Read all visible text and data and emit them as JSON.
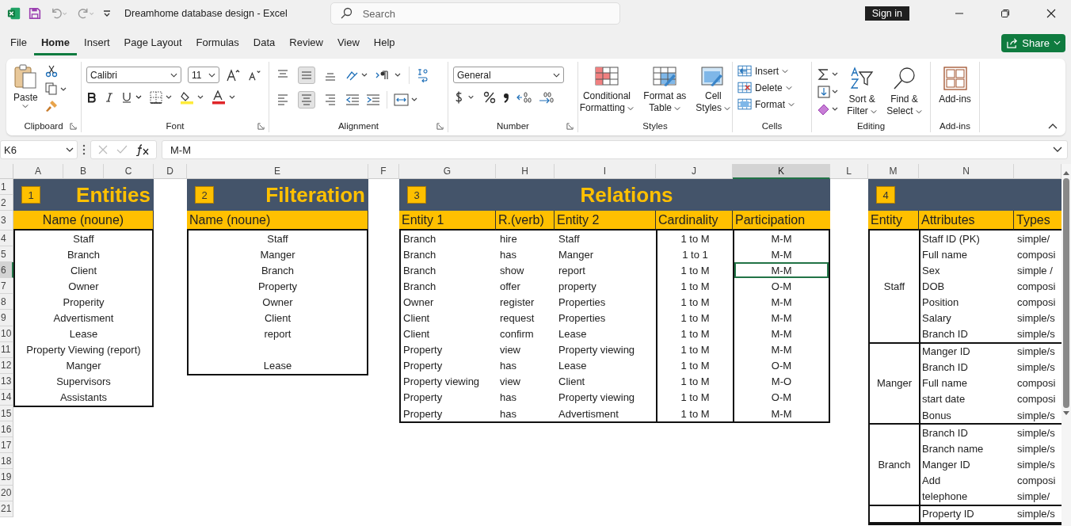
{
  "title_bar": {
    "document_title": "Dreamhome database design  -  Excel",
    "search_placeholder": "Search",
    "sign_in": "Sign in"
  },
  "menu_tabs": [
    {
      "label": "File",
      "selected": false
    },
    {
      "label": "Home",
      "selected": true
    },
    {
      "label": "Insert",
      "selected": false
    },
    {
      "label": "Page Layout",
      "selected": false
    },
    {
      "label": "Formulas",
      "selected": false
    },
    {
      "label": "Data",
      "selected": false
    },
    {
      "label": "Review",
      "selected": false
    },
    {
      "label": "View",
      "selected": false
    },
    {
      "label": "Help",
      "selected": false
    }
  ],
  "share_button": "Share",
  "ribbon": {
    "clipboard": {
      "paste": "Paste",
      "group": "Clipboard"
    },
    "font": {
      "font_name": "Calibri",
      "font_size": "11",
      "group": "Font"
    },
    "alignment": {
      "vertical_buttons": [
        {
          "selected": false
        },
        {
          "selected": true
        },
        {
          "selected": false
        }
      ],
      "horizontal_buttons": [
        {
          "selected": false
        },
        {
          "selected": true
        },
        {
          "selected": false
        }
      ],
      "group": "Alignment"
    },
    "number": {
      "format": "General",
      "group": "Number"
    },
    "styles": {
      "buttons": [
        [
          "Conditional",
          "Formatting"
        ],
        [
          "Format as",
          "Table"
        ],
        [
          "Cell",
          "Styles"
        ]
      ],
      "group": "Styles"
    },
    "cells": {
      "buttons": [
        "Insert",
        "Delete",
        "Format"
      ],
      "group": "Cells"
    },
    "editing": {
      "buttons": [
        [
          "Sort &",
          "Filter"
        ],
        [
          "Find &",
          "Select"
        ]
      ],
      "group": "Editing"
    },
    "addins": {
      "button": "Add-ins",
      "group": "Add-ins"
    }
  },
  "formula_bar": {
    "name_box": "K6",
    "formula": "M-M"
  },
  "sheet": {
    "columns": [
      {
        "label": "A",
        "selected": false
      },
      {
        "label": "B",
        "selected": false
      },
      {
        "label": "C",
        "selected": false
      },
      {
        "label": "D",
        "selected": false
      },
      {
        "label": "E",
        "selected": false
      },
      {
        "label": "F",
        "selected": false
      },
      {
        "label": "G",
        "selected": false
      },
      {
        "label": "H",
        "selected": false
      },
      {
        "label": "I",
        "selected": false
      },
      {
        "label": "J",
        "selected": false
      },
      {
        "label": "K",
        "selected": true
      },
      {
        "label": "L",
        "selected": false
      },
      {
        "label": "M",
        "selected": false
      },
      {
        "label": "N",
        "selected": false
      }
    ],
    "rows": [
      {
        "label": "1",
        "selected": false
      },
      {
        "label": "2",
        "selected": false
      },
      {
        "label": "3",
        "selected": false
      },
      {
        "label": "4",
        "selected": false
      },
      {
        "label": "5",
        "selected": false
      },
      {
        "label": "6",
        "selected": true
      },
      {
        "label": "7",
        "selected": false
      },
      {
        "label": "8",
        "selected": false
      },
      {
        "label": "9",
        "selected": false
      },
      {
        "label": "10",
        "selected": false
      },
      {
        "label": "11",
        "selected": false
      },
      {
        "label": "12",
        "selected": false
      },
      {
        "label": "13",
        "selected": false
      },
      {
        "label": "14",
        "selected": false
      },
      {
        "label": "15",
        "selected": false
      },
      {
        "label": "16",
        "selected": false
      },
      {
        "label": "17",
        "selected": false
      },
      {
        "label": "18",
        "selected": false
      },
      {
        "label": "19",
        "selected": false
      },
      {
        "label": "20",
        "selected": false
      },
      {
        "label": "21",
        "selected": false
      }
    ]
  },
  "entities": {
    "badge": "1",
    "title": "Entities",
    "header": "Name  (noune)",
    "items": [
      "Staff",
      "Branch",
      "Client",
      "Owner",
      "Properity",
      "Advertisment",
      "Lease",
      "Property Viewing (report)",
      "Manger",
      "Supervisors",
      "Assistants"
    ]
  },
  "filteration": {
    "badge": "2",
    "title": "Filteration",
    "header": "Name  (noune)",
    "items": [
      "Staff",
      "Manger",
      "Branch",
      "Property",
      "Owner",
      "Client",
      "report"
    ],
    "last_item": "Lease"
  },
  "relations": {
    "badge": "3",
    "title": "Relations",
    "headers": [
      "Entity 1",
      "R.(verb)",
      "Entity 2",
      "Cardinality",
      "Participation"
    ],
    "rows": [
      {
        "entity1": "Branch",
        "verb": "hire",
        "entity2": "Staff",
        "cardinality": "1 to M",
        "participation": "M-M",
        "selected": false
      },
      {
        "entity1": "Branch",
        "verb": "has",
        "entity2": "Manger",
        "cardinality": "1 to 1",
        "participation": "M-M",
        "selected": false
      },
      {
        "entity1": "Branch",
        "verb": "show",
        "entity2": "report",
        "cardinality": "1 to M",
        "participation": "M-M",
        "selected": true
      },
      {
        "entity1": "Branch",
        "verb": "offer",
        "entity2": "property",
        "cardinality": "1 to M",
        "participation": "O-M",
        "selected": false
      },
      {
        "entity1": "Owner",
        "verb": "register",
        "entity2": "Properties",
        "cardinality": "1 to M",
        "participation": "M-M",
        "selected": false
      },
      {
        "entity1": "Client",
        "verb": "request",
        "entity2": "Properties",
        "cardinality": "1 to M",
        "participation": "M-M",
        "selected": false
      },
      {
        "entity1": "Client",
        "verb": "confirm",
        "entity2": "Lease",
        "cardinality": "1 to M",
        "participation": "M-M",
        "selected": false
      },
      {
        "entity1": "Property",
        "verb": "view",
        "entity2": "Property viewing",
        "cardinality": "1 to M",
        "participation": "M-M",
        "selected": false
      },
      {
        "entity1": "Property",
        "verb": "has",
        "entity2": "Lease",
        "cardinality": "1 to M",
        "participation": "O-M",
        "selected": false
      },
      {
        "entity1": "Property viewing",
        "verb": "view",
        "entity2": "Client",
        "cardinality": "1 to M",
        "participation": "M-O",
        "selected": false
      },
      {
        "entity1": "Property",
        "verb": "has",
        "entity2": "Property viewing",
        "cardinality": "1 to M",
        "participation": "O-M",
        "selected": false
      },
      {
        "entity1": "Property",
        "verb": "has",
        "entity2": "Advertisment",
        "cardinality": "1 to M",
        "participation": "M-M",
        "selected": false
      }
    ]
  },
  "attributes": {
    "badge": "4",
    "headers": [
      "Entity",
      "Attributes",
      "Types"
    ],
    "groups": [
      {
        "entity": "Staff",
        "attributes": [
          {
            "name": "Staff ID (PK)",
            "type": "simple/"
          },
          {
            "name": "Full name",
            "type": "composi"
          },
          {
            "name": "Sex",
            "type": "simple /"
          },
          {
            "name": "DOB",
            "type": "composi"
          },
          {
            "name": "Position",
            "type": "composi"
          },
          {
            "name": "Salary",
            "type": "simple/s"
          },
          {
            "name": "Branch ID",
            "type": "simple/s"
          }
        ]
      },
      {
        "entity": "Manger",
        "attributes": [
          {
            "name": "Manger ID",
            "type": "simple/s"
          },
          {
            "name": "Branch ID",
            "type": "simple/s"
          },
          {
            "name": "Full name",
            "type": "composi"
          },
          {
            "name": "start date",
            "type": "composi"
          },
          {
            "name": "Bonus",
            "type": "simple/s"
          }
        ]
      },
      {
        "entity": "Branch",
        "attributes": [
          {
            "name": "Branch ID",
            "type": "simple/s"
          },
          {
            "name": "Branch name",
            "type": "simple/s"
          },
          {
            "name": "Manger ID",
            "type": "simple/s"
          },
          {
            "name": "Add",
            "type": "composi"
          },
          {
            "name": "telephone",
            "type": "simple/"
          }
        ]
      },
      {
        "attributes": [
          {
            "name": "Property ID",
            "type": "simple/s"
          }
        ]
      }
    ]
  }
}
